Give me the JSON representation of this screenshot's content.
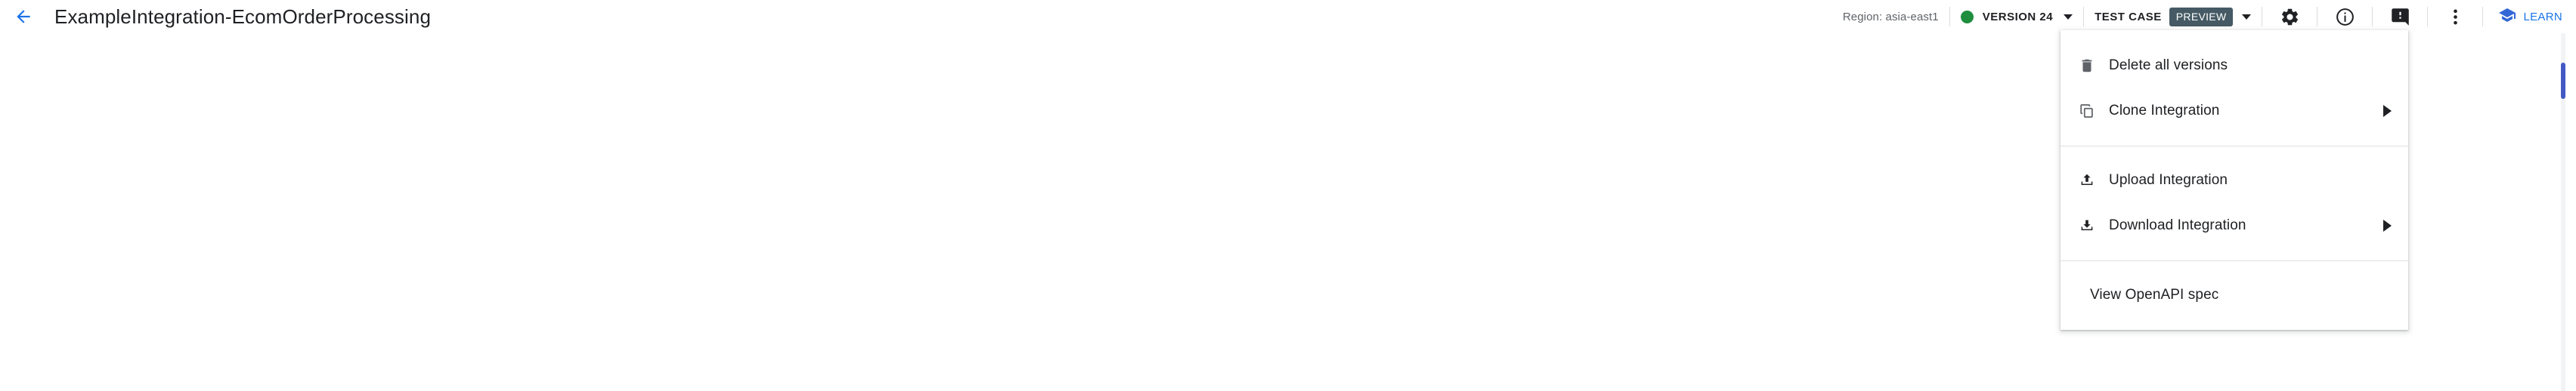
{
  "header": {
    "back_icon": "arrow-back-icon",
    "title": "ExampleIntegration-EcomOrderProcessing",
    "region_label": "Region: asia-east1",
    "version": {
      "status_dot": "status-dot-green",
      "label": "VERSION 24",
      "dropdown_icon": "chevron-down-icon"
    },
    "test_case": {
      "label": "TEST CASE",
      "badge": "PREVIEW",
      "dropdown_icon": "chevron-down-icon"
    },
    "actions": [
      {
        "name": "settings-button",
        "icon": "gear-icon"
      },
      {
        "name": "info-button",
        "icon": "info-circle-icon"
      },
      {
        "name": "feedback-button",
        "icon": "feedback-icon"
      },
      {
        "name": "overflow-menu-button",
        "icon": "kebab-menu-icon"
      }
    ],
    "learn": {
      "label": "LEARN",
      "icon": "graduation-cap-icon"
    }
  },
  "overflow_menu": {
    "items": [
      {
        "label": "Delete all versions",
        "icon": "trash-icon",
        "submenu": false,
        "divider_after": false
      },
      {
        "label": "Clone Integration",
        "icon": "copy-icon",
        "submenu": true,
        "divider_after": true
      },
      {
        "label": "Upload Integration",
        "icon": "upload-icon",
        "submenu": false,
        "divider_after": false
      },
      {
        "label": "Download Integration",
        "icon": "download-icon",
        "submenu": true,
        "divider_after": true
      },
      {
        "label": "View OpenAPI spec",
        "icon": null,
        "submenu": false,
        "divider_after": false
      }
    ]
  },
  "scrollbar": {
    "name": "vertical-scrollbar"
  },
  "colors": {
    "accent_blue": "#1a73e8",
    "status_green": "#1e8e3e",
    "badge_slate": "#455a64",
    "text_primary": "#202124",
    "text_secondary": "#5f6368",
    "scroll_thumb": "#4259c4"
  }
}
